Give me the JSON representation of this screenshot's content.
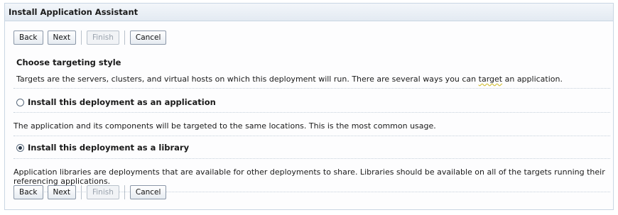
{
  "window": {
    "title": "Install Application Assistant"
  },
  "toolbar": {
    "back": "Back",
    "next": "Next",
    "finish": "Finish",
    "cancel": "Cancel"
  },
  "section": {
    "heading": "Choose targeting style",
    "intro_before": "Targets are the servers, clusters, and virtual hosts on which this deployment will run. There are several ways you can ",
    "intro_underlined": "target",
    "intro_after": " an application."
  },
  "options": [
    {
      "label": "Install this deployment as an application",
      "checked": false,
      "description": "The application and its components will be targeted to the same locations. This is the most common usage."
    },
    {
      "label": "Install this deployment as a library",
      "checked": true,
      "description": "Application libraries are deployments that are available for other deployments to share. Libraries should be available on all of the targets running their referencing applications."
    }
  ]
}
